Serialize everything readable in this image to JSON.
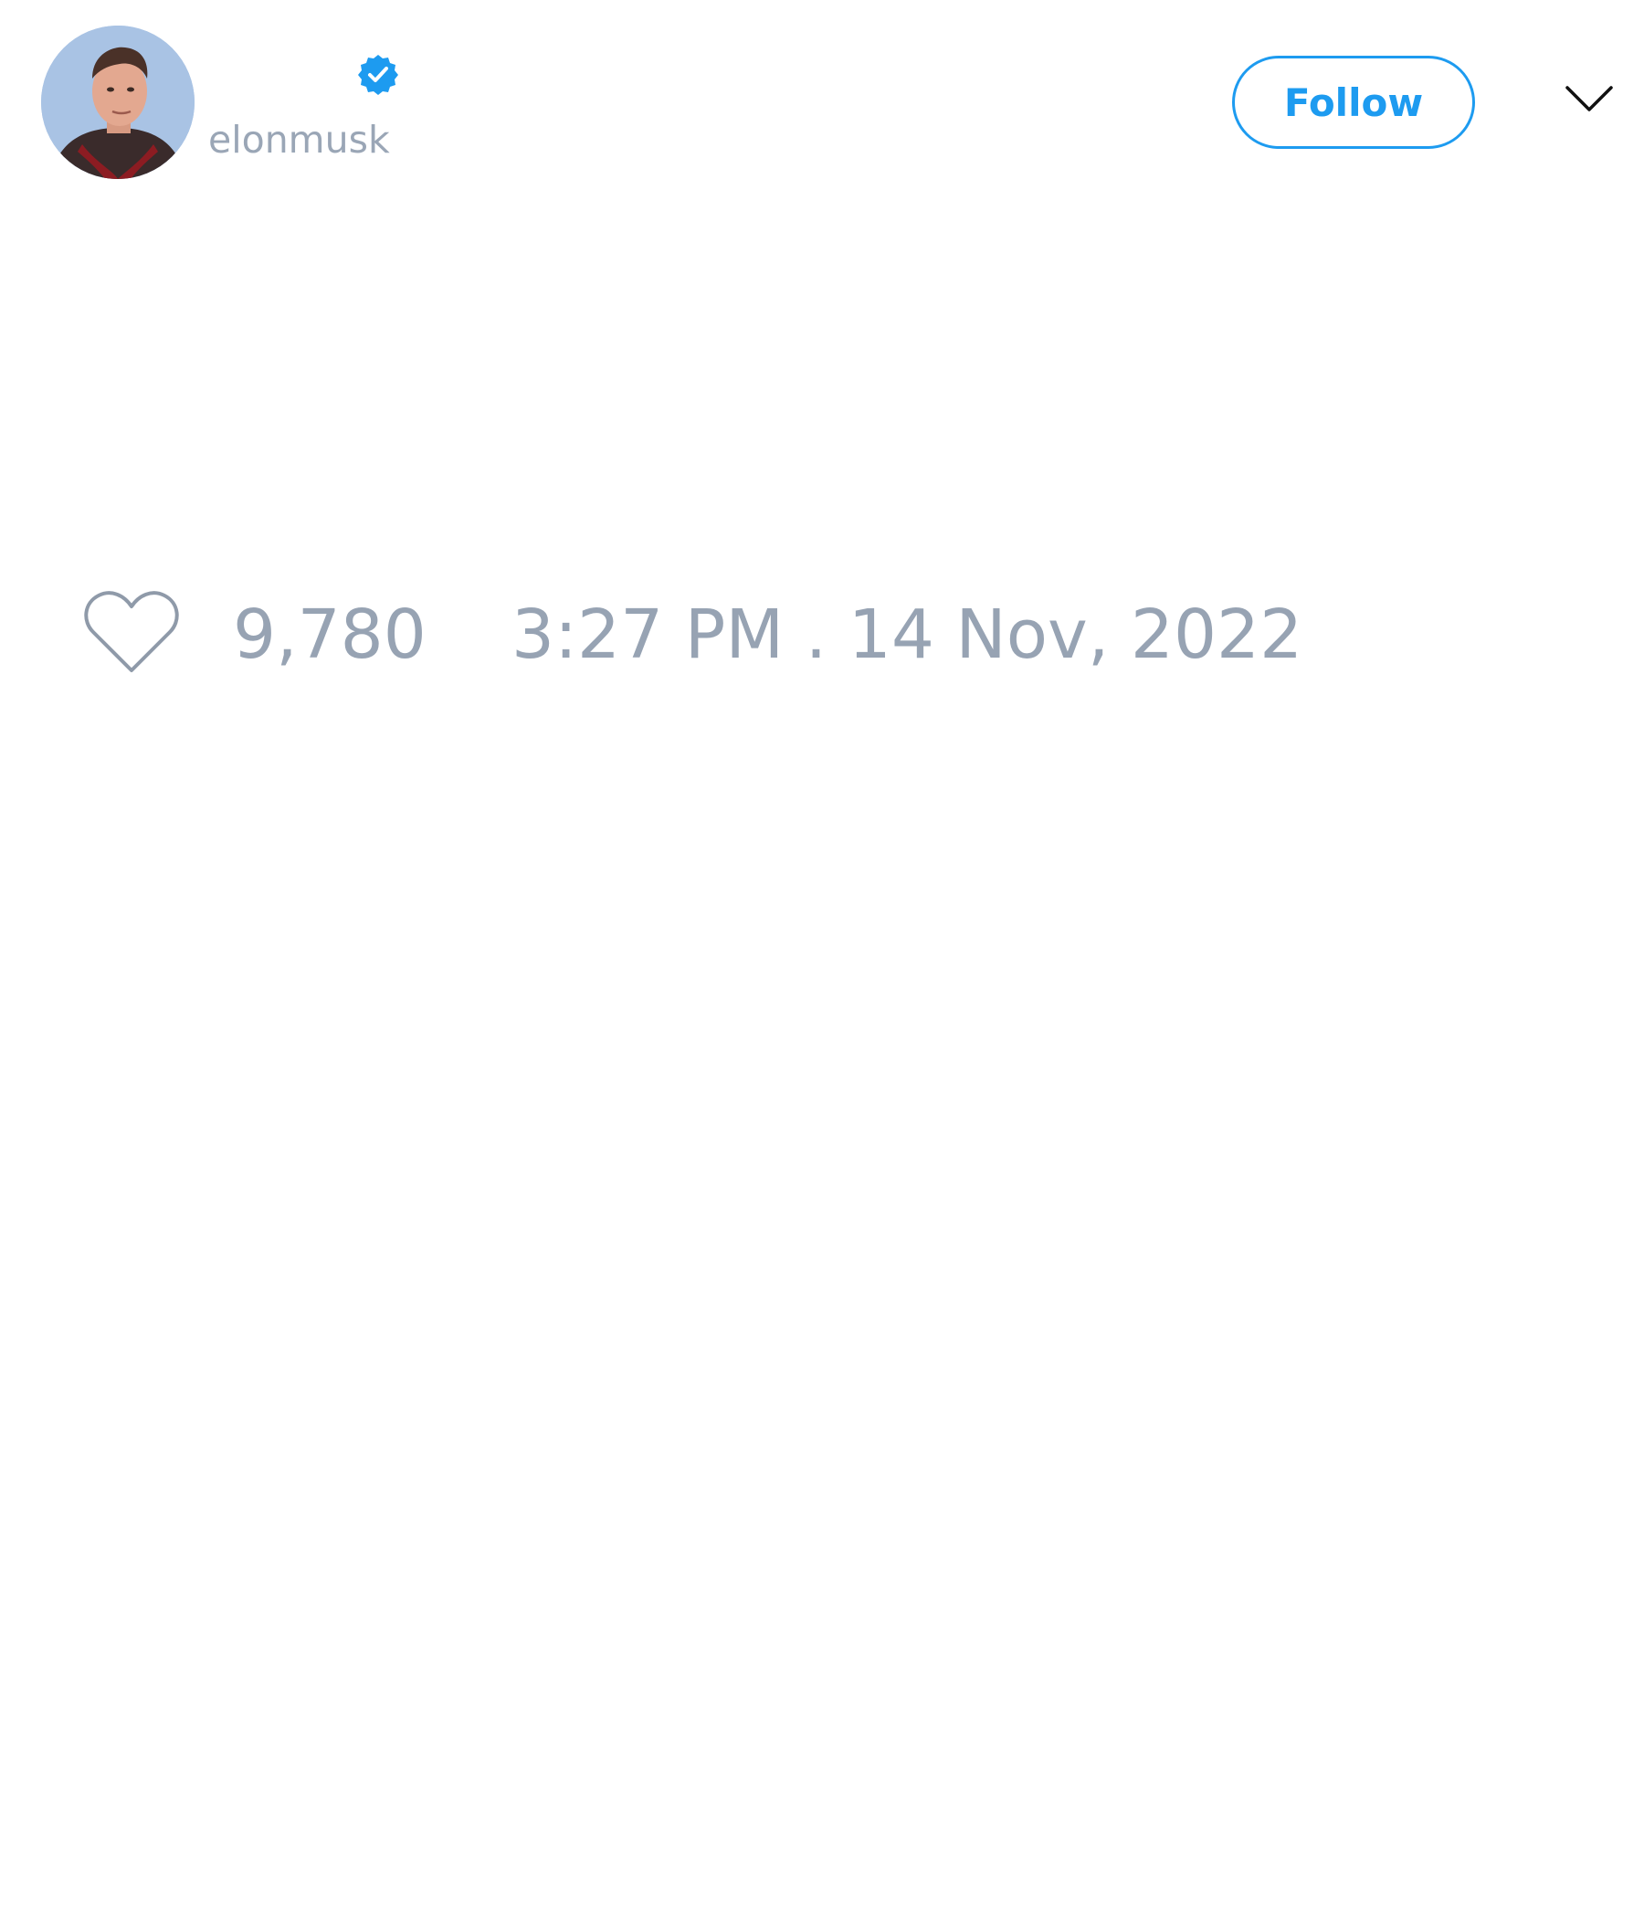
{
  "author": {
    "handle": "elonmusk",
    "verified": true,
    "avatar_icon": "profile-photo"
  },
  "actions": {
    "follow_label": "Follow",
    "menu_icon": "chevron-down-icon"
  },
  "stats": {
    "like_icon": "heart-icon",
    "like_count": "9,780",
    "timestamp": "3:27 PM . 14 Nov, 2022"
  },
  "colors": {
    "accent": "#1d9bf0",
    "muted_text": "#97a3b3",
    "background": "#ffffff"
  }
}
